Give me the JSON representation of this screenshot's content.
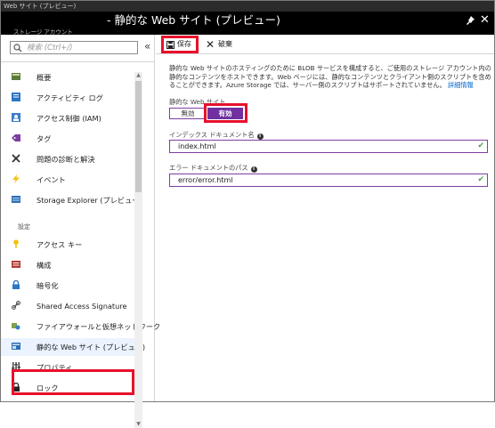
{
  "titlebar": "Web サイト (プレビュー)",
  "header": {
    "title": "- 静的な Web サイト (プレビュー)",
    "subtitle": "ストレージ アカウント"
  },
  "search": {
    "placeholder": "検索 (Ctrl+/)"
  },
  "collapse_glyph": "«",
  "menu": {
    "items": [
      {
        "label": "概要",
        "icon": "overview-icon"
      },
      {
        "label": "アクティビティ ログ",
        "icon": "activity-log-icon"
      },
      {
        "label": "アクセス制御 (IAM)",
        "icon": "iam-icon"
      },
      {
        "label": "タグ",
        "icon": "tag-icon"
      },
      {
        "label": "問題の診断と解決",
        "icon": "wrench-icon"
      },
      {
        "label": "イベント",
        "icon": "lightning-icon"
      },
      {
        "label": "Storage Explorer (プレビュー)",
        "icon": "storage-explorer-icon"
      }
    ],
    "section_label": "設定",
    "settings": [
      {
        "label": "アクセス キー",
        "icon": "key-icon"
      },
      {
        "label": "構成",
        "icon": "config-icon"
      },
      {
        "label": "暗号化",
        "icon": "lock-icon"
      },
      {
        "label": "Shared Access Signature",
        "icon": "link-icon"
      },
      {
        "label": "ファイアウォールと仮想ネットワーク",
        "icon": "firewall-icon"
      },
      {
        "label": "静的な Web サイト (プレビュー)",
        "icon": "static-website-icon"
      },
      {
        "label": "プロパティ",
        "icon": "properties-icon"
      },
      {
        "label": "ロック",
        "icon": "lock-icon"
      }
    ]
  },
  "toolbar": {
    "save_label": "保存",
    "discard_label": "破棄"
  },
  "description": "静的な Web サイトのホスティングのために BLOB サービスを構成すると、ご使用のストレージ アカウント内の静的なコンテンツをホストできます。Web ページには、静的なコンテンツとクライアント側のスクリプトを含めることができます。Azure Storage では、サーバー側のスクリプトはサポートされていません。",
  "description_link": "詳細情報",
  "static_site": {
    "label": "静的な Web サイト",
    "off_label": "無効",
    "on_label": "有効",
    "selected": "有効"
  },
  "index_doc": {
    "label": "インデックス ドキュメント名",
    "value": "index.html"
  },
  "error_doc": {
    "label": "エラー ドキュメントのパス",
    "value": "error/error.html"
  },
  "colors": {
    "accent": "#7030a0",
    "highlight": "#e8102a",
    "header_bg": "#000000"
  }
}
